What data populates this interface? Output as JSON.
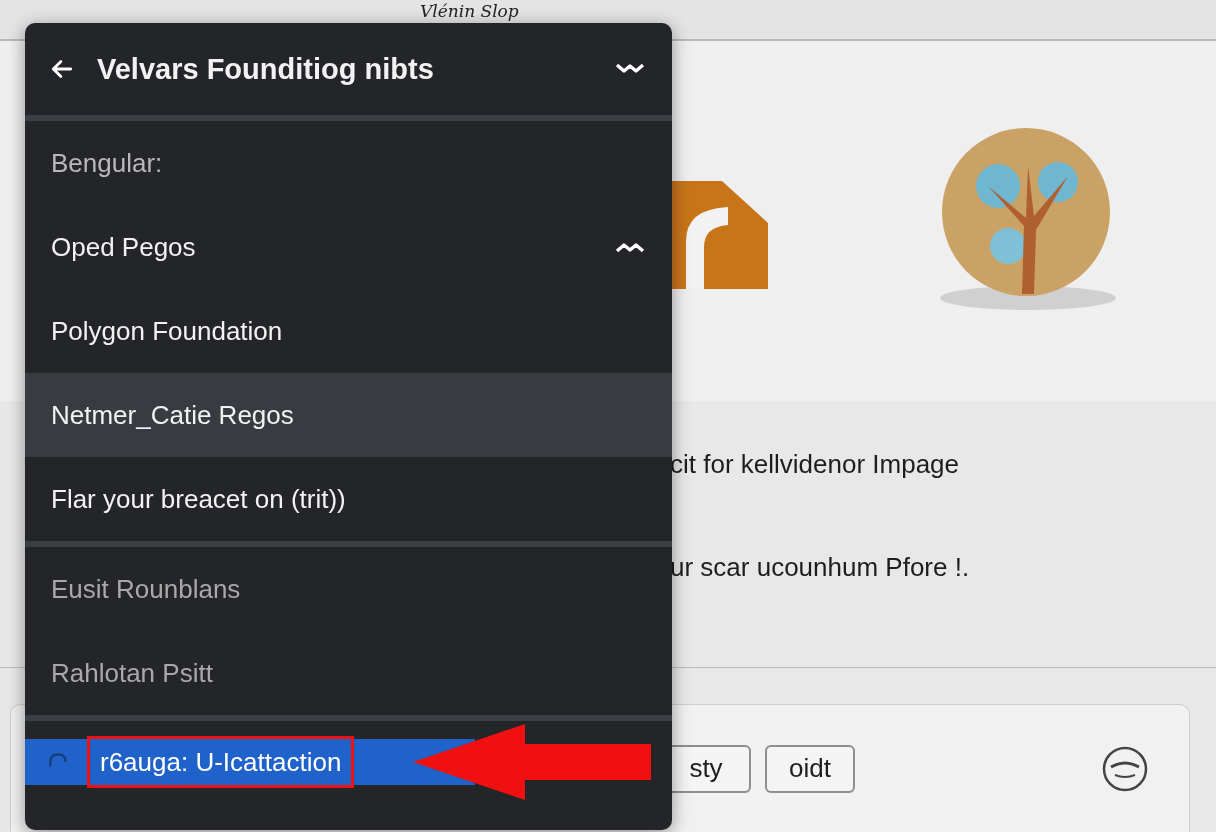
{
  "top_bar": {
    "title": "Vlénin Slop"
  },
  "menu": {
    "title": "Velvars Founditiog nibts",
    "groups": [
      {
        "items": [
          {
            "kind": "heading",
            "label": "Bengular:"
          },
          {
            "kind": "expander",
            "label": "Oped Pegos",
            "expanded": true
          },
          {
            "kind": "option",
            "label": "Polygon Foundation",
            "hovered": false,
            "disabled": false,
            "selected": false
          },
          {
            "kind": "option",
            "label": "Netmer_Catie Regos",
            "hovered": true,
            "disabled": false,
            "selected": false
          },
          {
            "kind": "option",
            "label": "Flar your breacet on (trit))",
            "hovered": false,
            "disabled": false,
            "selected": false
          }
        ]
      },
      {
        "items": [
          {
            "kind": "option",
            "label": "Eusit Rounblans",
            "hovered": false,
            "disabled": true,
            "selected": false
          },
          {
            "kind": "option",
            "label": "Rahlotan Psitt",
            "hovered": false,
            "disabled": true,
            "selected": false
          }
        ]
      },
      {
        "items": [
          {
            "kind": "option",
            "label": "r6auga: U-Icattaction",
            "selected": true
          }
        ]
      }
    ]
  },
  "annotation": {
    "box": true,
    "arrow": true
  },
  "paragraphs": [
    "cit for kellvidenor Impage",
    "ur scar ucounhum Pfore !."
  ],
  "buttons": [
    "sty",
    "oidt"
  ]
}
